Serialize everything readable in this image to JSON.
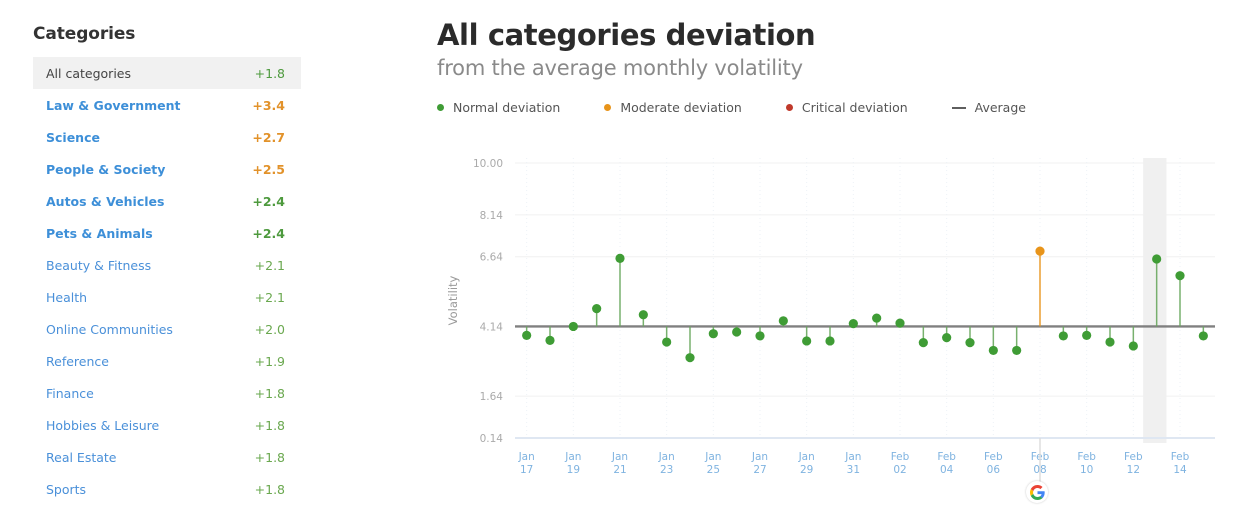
{
  "sidebar": {
    "title": "Categories",
    "items": [
      {
        "label": "All categories",
        "value": "+1.8",
        "state": "active",
        "value_color": "green"
      },
      {
        "label": "Law & Government",
        "value": "+3.4",
        "state": "bold",
        "value_color": "orange"
      },
      {
        "label": "Science",
        "value": "+2.7",
        "state": "bold",
        "value_color": "orange"
      },
      {
        "label": "People & Society",
        "value": "+2.5",
        "state": "bold",
        "value_color": "orange"
      },
      {
        "label": "Autos & Vehicles",
        "value": "+2.4",
        "state": "bold",
        "value_color": "green"
      },
      {
        "label": "Pets & Animals",
        "value": "+2.4",
        "state": "bold",
        "value_color": "green"
      },
      {
        "label": "Beauty & Fitness",
        "value": "+2.1",
        "state": "normal",
        "value_color": "greenlight"
      },
      {
        "label": "Health",
        "value": "+2.1",
        "state": "normal",
        "value_color": "greenlight"
      },
      {
        "label": "Online Communities",
        "value": "+2.0",
        "state": "normal",
        "value_color": "greenlight"
      },
      {
        "label": "Reference",
        "value": "+1.9",
        "state": "normal",
        "value_color": "greenlight"
      },
      {
        "label": "Finance",
        "value": "+1.8",
        "state": "normal",
        "value_color": "greenlight"
      },
      {
        "label": "Hobbies & Leisure",
        "value": "+1.8",
        "state": "normal",
        "value_color": "greenlight"
      },
      {
        "label": "Real Estate",
        "value": "+1.8",
        "state": "normal",
        "value_color": "greenlight"
      },
      {
        "label": "Sports",
        "value": "+1.8",
        "state": "normal",
        "value_color": "greenlight"
      }
    ]
  },
  "header": {
    "title": "All categories deviation",
    "subtitle": "from the average monthly volatility"
  },
  "legend": [
    {
      "label": "Normal deviation",
      "marker": "dot",
      "color": "#3f9c35"
    },
    {
      "label": "Moderate deviation",
      "marker": "dot",
      "color": "#e8941a"
    },
    {
      "label": "Critical deviation",
      "marker": "dot",
      "color": "#c0392b"
    },
    {
      "label": "Average",
      "marker": "line",
      "color": "#5e5e5e"
    }
  ],
  "colors": {
    "normal": "#3f9c35",
    "moderate": "#e8941a",
    "critical": "#c0392b",
    "average_line": "#808080",
    "stem": "#6aa95f",
    "grid": "#f0f0f0",
    "xtick": "#7fb3e0",
    "highlight_band": "#ededed",
    "sidebar_link": "#4a90d9"
  },
  "branding": {
    "logo": "google-g-logo"
  },
  "chart_data": {
    "type": "scatter",
    "title": "All categories deviation",
    "subtitle": "from the average monthly volatility",
    "ylabel": "Volatility",
    "xlabel": "",
    "ylim": [
      0.14,
      10.0
    ],
    "yticks": [
      10.0,
      8.14,
      6.64,
      4.14,
      1.64,
      0.14
    ],
    "ytick_labels": [
      "10.00",
      "8.14",
      "6.64",
      "4.14",
      "1.64",
      "0.14"
    ],
    "average": 4.14,
    "grid": true,
    "legend_position": "top",
    "xtick_labels": [
      {
        "month": "Jan",
        "day": "17"
      },
      {
        "month": "Jan",
        "day": "19"
      },
      {
        "month": "Jan",
        "day": "21"
      },
      {
        "month": "Jan",
        "day": "23"
      },
      {
        "month": "Jan",
        "day": "25"
      },
      {
        "month": "Jan",
        "day": "27"
      },
      {
        "month": "Jan",
        "day": "29"
      },
      {
        "month": "Jan",
        "day": "31"
      },
      {
        "month": "Feb",
        "day": "02"
      },
      {
        "month": "Feb",
        "day": "04"
      },
      {
        "month": "Feb",
        "day": "06"
      },
      {
        "month": "Feb",
        "day": "08"
      },
      {
        "month": "Feb",
        "day": "10"
      },
      {
        "month": "Feb",
        "day": "12"
      },
      {
        "month": "Feb",
        "day": "14"
      }
    ],
    "highlight_band": {
      "start_date": "Feb 12",
      "end_date": "Feb 13"
    },
    "points": [
      {
        "date": "Jan 17",
        "value": 3.82,
        "severity": "normal"
      },
      {
        "date": "Jan 18",
        "value": 3.64,
        "severity": "normal"
      },
      {
        "date": "Jan 19",
        "value": 4.14,
        "severity": "normal"
      },
      {
        "date": "Jan 20",
        "value": 4.78,
        "severity": "normal"
      },
      {
        "date": "Jan 21",
        "value": 6.58,
        "severity": "normal"
      },
      {
        "date": "Jan 22",
        "value": 4.56,
        "severity": "normal"
      },
      {
        "date": "Jan 23",
        "value": 3.58,
        "severity": "normal"
      },
      {
        "date": "Jan 24",
        "value": 3.02,
        "severity": "normal"
      },
      {
        "date": "Jan 25",
        "value": 3.88,
        "severity": "normal"
      },
      {
        "date": "Jan 26",
        "value": 3.94,
        "severity": "normal"
      },
      {
        "date": "Jan 27",
        "value": 3.8,
        "severity": "normal"
      },
      {
        "date": "Jan 28",
        "value": 4.34,
        "severity": "normal"
      },
      {
        "date": "Jan 29",
        "value": 3.62,
        "severity": "normal"
      },
      {
        "date": "Jan 30",
        "value": 3.62,
        "severity": "normal"
      },
      {
        "date": "Jan 31",
        "value": 4.24,
        "severity": "normal"
      },
      {
        "date": "Feb 01",
        "value": 4.44,
        "severity": "normal"
      },
      {
        "date": "Feb 02",
        "value": 4.26,
        "severity": "normal"
      },
      {
        "date": "Feb 03",
        "value": 3.56,
        "severity": "normal"
      },
      {
        "date": "Feb 04",
        "value": 3.74,
        "severity": "normal"
      },
      {
        "date": "Feb 05",
        "value": 3.56,
        "severity": "normal"
      },
      {
        "date": "Feb 06",
        "value": 3.28,
        "severity": "normal"
      },
      {
        "date": "Feb 07",
        "value": 3.28,
        "severity": "normal"
      },
      {
        "date": "Feb 08",
        "value": 6.84,
        "severity": "moderate"
      },
      {
        "date": "Feb 09",
        "value": 3.8,
        "severity": "normal"
      },
      {
        "date": "Feb 10",
        "value": 3.82,
        "severity": "normal"
      },
      {
        "date": "Feb 11",
        "value": 3.58,
        "severity": "normal"
      },
      {
        "date": "Feb 12",
        "value": 3.44,
        "severity": "normal"
      },
      {
        "date": "Feb 13",
        "value": 6.56,
        "severity": "normal"
      },
      {
        "date": "Feb 14",
        "value": 5.96,
        "severity": "normal"
      },
      {
        "date": "Feb 15",
        "value": 3.8,
        "severity": "normal"
      }
    ]
  }
}
